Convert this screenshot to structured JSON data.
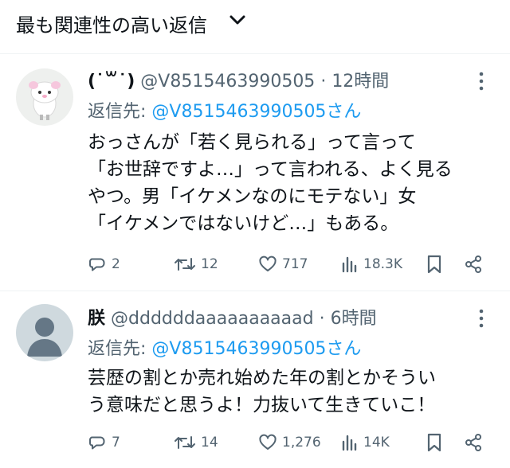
{
  "sort": {
    "label": "最も関連性の高い返信"
  },
  "tweets": [
    {
      "display_name": "(˙꒳˙)",
      "handle": "@V8515463990505",
      "separator": "·",
      "time": "12時間",
      "reply_prefix": "返信先:",
      "reply_mention": "@V8515463990505さん",
      "text": "おっさんが「若く見られる」って言って\n「お世辞ですよ…」って言われる、よく見る\nやつ。男「イケメンなのにモテない」女\n「イケメンではないけど…」もある。",
      "replies": "2",
      "retweets": "12",
      "likes": "717",
      "views": "18.3K"
    },
    {
      "display_name": "朕",
      "handle": "@ddddddaaaaaaaaaad",
      "separator": "·",
      "time": "6時間",
      "reply_prefix": "返信先:",
      "reply_mention": "@V8515463990505さん",
      "text": "芸歴の割とか売れ始めた年の割とかそうい\nう意味だと思うよ！力抜いて生きていこ！",
      "replies": "7",
      "retweets": "14",
      "likes": "1,276",
      "views": "14K"
    }
  ],
  "colors": {
    "accent": "#1d9bf0",
    "muted": "#536471",
    "text": "#0f1419"
  }
}
